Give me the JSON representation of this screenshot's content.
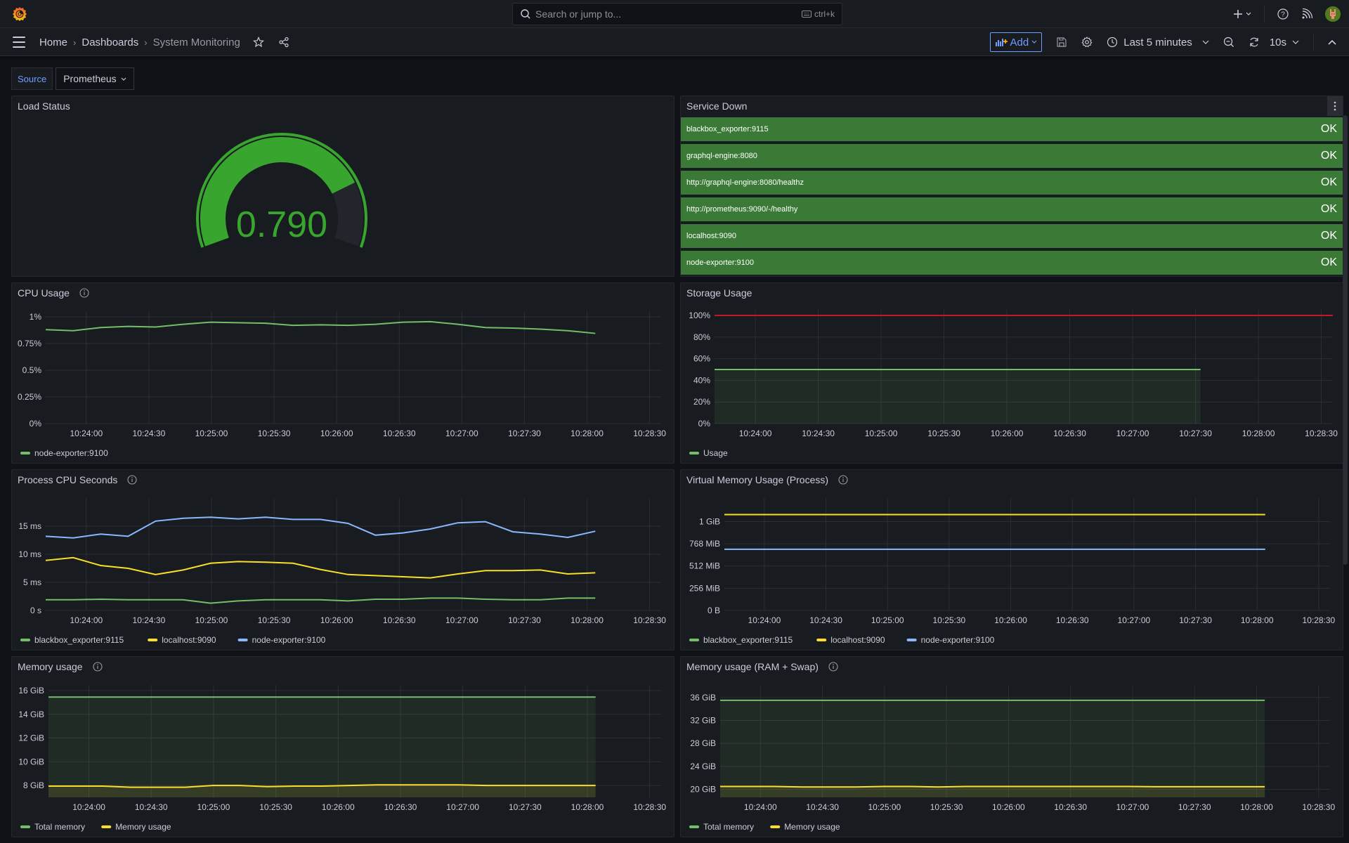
{
  "topbar": {
    "search_placeholder": "Search or jump to...",
    "search_shortcut": "ctrl+k",
    "icons": [
      "grafana-logo-icon",
      "search-icon",
      "keyboard-icon",
      "plus-icon",
      "help-icon",
      "news-feed-icon",
      "avatar"
    ]
  },
  "navbar": {
    "breadcrumbs": [
      "Home",
      "Dashboards",
      "System Monitoring"
    ],
    "add_label": "Add",
    "time_range": "Last 5 minutes",
    "refresh_interval": "10s"
  },
  "variables": {
    "label": "Source",
    "value": "Prometheus"
  },
  "colors": {
    "green": "#73bf69",
    "yellow": "#fade2a",
    "blue": "#8ab8ff",
    "red": "#c4162a",
    "gauge_green": "#37a52e",
    "ok_bg": "#3b7a36",
    "accent": "#6e9fff"
  },
  "panels": {
    "load_status": {
      "title": "Load Status",
      "value": "0.790",
      "gauge_fraction": 0.79
    },
    "service_down": {
      "title": "Service Down",
      "rows": [
        {
          "name": "blackbox_exporter:9115",
          "status": "OK"
        },
        {
          "name": "graphql-engine:8080",
          "status": "OK"
        },
        {
          "name": "http://graphql-engine:8080/healthz",
          "status": "OK"
        },
        {
          "name": "http://prometheus:9090/-/healthy",
          "status": "OK"
        },
        {
          "name": "localhost:9090",
          "status": "OK"
        },
        {
          "name": "node-exporter:9100",
          "status": "OK"
        }
      ]
    },
    "cpu_usage": {
      "title": "CPU Usage"
    },
    "storage_usage": {
      "title": "Storage Usage"
    },
    "process_cpu": {
      "title": "Process CPU Seconds"
    },
    "virtual_memory": {
      "title": "Virtual Memory Usage (Process)"
    },
    "memory_usage": {
      "title": "Memory usage"
    },
    "memory_swap": {
      "title": "Memory usage (RAM + Swap)"
    }
  },
  "chart_data": [
    {
      "id": "cpu_usage",
      "type": "line",
      "title": "CPU Usage",
      "x": [
        "10:23:55",
        "10:24:00",
        "10:24:15",
        "10:24:30",
        "10:24:45",
        "10:25:00",
        "10:25:15",
        "10:25:30",
        "10:25:45",
        "10:26:00",
        "10:26:15",
        "10:26:30",
        "10:26:45",
        "10:27:00",
        "10:27:15",
        "10:27:30",
        "10:27:45",
        "10:28:00",
        "10:28:15",
        "10:28:30",
        "10:28:45"
      ],
      "xticks": [
        "10:24:00",
        "10:24:30",
        "10:25:00",
        "10:25:30",
        "10:26:00",
        "10:26:30",
        "10:27:00",
        "10:27:30",
        "10:28:00",
        "10:28:30"
      ],
      "yticks": [
        "0%",
        "0.25%",
        "0.5%",
        "0.75%",
        "1%"
      ],
      "ylim": [
        0,
        1
      ],
      "series": [
        {
          "name": "node-exporter:9100",
          "color": "#73bf69",
          "values": [
            0.88,
            0.87,
            0.9,
            0.91,
            0.905,
            0.93,
            0.95,
            0.945,
            0.94,
            0.92,
            0.925,
            0.92,
            0.93,
            0.95,
            0.955,
            0.93,
            0.9,
            0.895,
            0.885,
            0.87,
            0.845
          ]
        }
      ]
    },
    {
      "id": "storage_usage",
      "type": "area",
      "title": "Storage Usage",
      "xticks": [
        "10:24:00",
        "10:24:30",
        "10:25:00",
        "10:25:30",
        "10:26:00",
        "10:26:30",
        "10:27:00",
        "10:27:30",
        "10:28:00",
        "10:28:30"
      ],
      "yticks": [
        "0%",
        "20%",
        "40%",
        "60%",
        "80%",
        "100%"
      ],
      "ylim": [
        0,
        100
      ],
      "threshold": {
        "value": 100,
        "color": "#c4162a"
      },
      "series": [
        {
          "name": "Usage",
          "color": "#73bf69",
          "values": [
            50,
            50,
            50,
            50,
            50,
            50,
            50,
            50,
            50,
            50,
            50,
            50,
            50,
            50,
            50,
            50,
            50,
            50,
            50,
            50
          ]
        }
      ]
    },
    {
      "id": "process_cpu",
      "type": "line",
      "title": "Process CPU Seconds",
      "xticks": [
        "10:24:00",
        "10:24:30",
        "10:25:00",
        "10:25:30",
        "10:26:00",
        "10:26:30",
        "10:27:00",
        "10:27:30",
        "10:28:00",
        "10:28:30"
      ],
      "yticks": [
        "0 s",
        "5 ms",
        "10 ms",
        "15 ms"
      ],
      "ylim": [
        0,
        19
      ],
      "series": [
        {
          "name": "blackbox_exporter:9115",
          "color": "#73bf69",
          "values": [
            1.9,
            1.9,
            2.0,
            1.9,
            1.9,
            1.9,
            1.3,
            1.7,
            1.9,
            1.9,
            1.9,
            1.7,
            2.0,
            2.0,
            2.2,
            2.2,
            2.0,
            1.9,
            1.9,
            2.2,
            2.2
          ]
        },
        {
          "name": "localhost:9090",
          "color": "#fade2a",
          "values": [
            8.9,
            9.4,
            8.0,
            7.5,
            6.4,
            7.2,
            8.4,
            8.7,
            8.6,
            8.4,
            7.3,
            6.4,
            6.2,
            6.0,
            5.8,
            6.5,
            7.1,
            7.1,
            7.2,
            6.5,
            6.7
          ]
        },
        {
          "name": "node-exporter:9100",
          "color": "#8ab8ff",
          "values": [
            13.2,
            12.9,
            13.6,
            13.2,
            15.9,
            16.4,
            16.6,
            16.3,
            16.6,
            16.2,
            16.2,
            15.5,
            13.4,
            13.8,
            14.5,
            15.6,
            15.8,
            14.0,
            13.6,
            13.0,
            14.1
          ]
        }
      ]
    },
    {
      "id": "virtual_memory",
      "type": "line",
      "title": "Virtual Memory Usage (Process)",
      "xticks": [
        "10:24:00",
        "10:24:30",
        "10:25:00",
        "10:25:30",
        "10:26:00",
        "10:26:30",
        "10:27:00",
        "10:27:30",
        "10:28:00",
        "10:28:30"
      ],
      "yticks": [
        "0 B",
        "256 MiB",
        "512 MiB",
        "768 MiB",
        "1 GiB"
      ],
      "ylim": [
        0,
        1230
      ],
      "series": [
        {
          "name": "blackbox_exporter:9115",
          "color": "#73bf69",
          "values": []
        },
        {
          "name": "localhost:9090",
          "color": "#fade2a",
          "values": [
            1105,
            1105,
            1105,
            1105,
            1105,
            1105,
            1105,
            1105,
            1105,
            1105,
            1105,
            1105,
            1105,
            1105,
            1105,
            1105,
            1105,
            1105,
            1105,
            1105,
            1105
          ]
        },
        {
          "name": "node-exporter:9100",
          "color": "#8ab8ff",
          "values": [
            705,
            705,
            705,
            705,
            705,
            705,
            705,
            705,
            705,
            705,
            705,
            705,
            705,
            705,
            705,
            705,
            705,
            705,
            705,
            705,
            705
          ]
        }
      ]
    },
    {
      "id": "memory_usage",
      "type": "area",
      "title": "Memory usage",
      "xticks": [
        "10:24:00",
        "10:24:30",
        "10:25:00",
        "10:25:30",
        "10:26:00",
        "10:26:30",
        "10:27:00",
        "10:27:30",
        "10:28:00",
        "10:28:30"
      ],
      "yticks": [
        "8 GiB",
        "10 GiB",
        "12 GiB",
        "14 GiB",
        "16 GiB"
      ],
      "ylim": [
        7,
        16
      ],
      "series": [
        {
          "name": "Total memory",
          "color": "#73bf69",
          "values": [
            15.45,
            15.45,
            15.45,
            15.45,
            15.45,
            15.45,
            15.45,
            15.45,
            15.45,
            15.45,
            15.45,
            15.45,
            15.45,
            15.45,
            15.45,
            15.45,
            15.45,
            15.45,
            15.45,
            15.45,
            15.45
          ]
        },
        {
          "name": "Memory usage",
          "color": "#fade2a",
          "values": [
            7.95,
            7.95,
            7.95,
            7.85,
            7.85,
            7.85,
            8.0,
            8.0,
            7.9,
            7.95,
            7.95,
            8.0,
            8.05,
            8.05,
            8.05,
            8.05,
            8.0,
            8.0,
            8.0,
            8.0,
            8.0
          ]
        }
      ]
    },
    {
      "id": "memory_swap",
      "type": "area",
      "title": "Memory usage (RAM + Swap)",
      "xticks": [
        "10:24:00",
        "10:24:30",
        "10:25:00",
        "10:25:30",
        "10:26:00",
        "10:26:30",
        "10:27:00",
        "10:27:30",
        "10:28:00",
        "10:28:30"
      ],
      "yticks": [
        "20 GiB",
        "24 GiB",
        "28 GiB",
        "32 GiB",
        "36 GiB"
      ],
      "ylim": [
        18.6,
        37.2
      ],
      "series": [
        {
          "name": "Total memory",
          "color": "#73bf69",
          "values": [
            35.5,
            35.5,
            35.5,
            35.5,
            35.5,
            35.5,
            35.5,
            35.5,
            35.5,
            35.5,
            35.5,
            35.5,
            35.5,
            35.5,
            35.5,
            35.5,
            35.5,
            35.5,
            35.5,
            35.5,
            35.5
          ]
        },
        {
          "name": "Memory usage",
          "color": "#fade2a",
          "values": [
            20.5,
            20.5,
            20.5,
            20.4,
            20.4,
            20.4,
            20.5,
            20.5,
            20.4,
            20.5,
            20.5,
            20.5,
            20.5,
            20.5,
            20.5,
            20.5,
            20.45,
            20.45,
            20.45,
            20.45,
            20.45
          ]
        }
      ]
    }
  ]
}
